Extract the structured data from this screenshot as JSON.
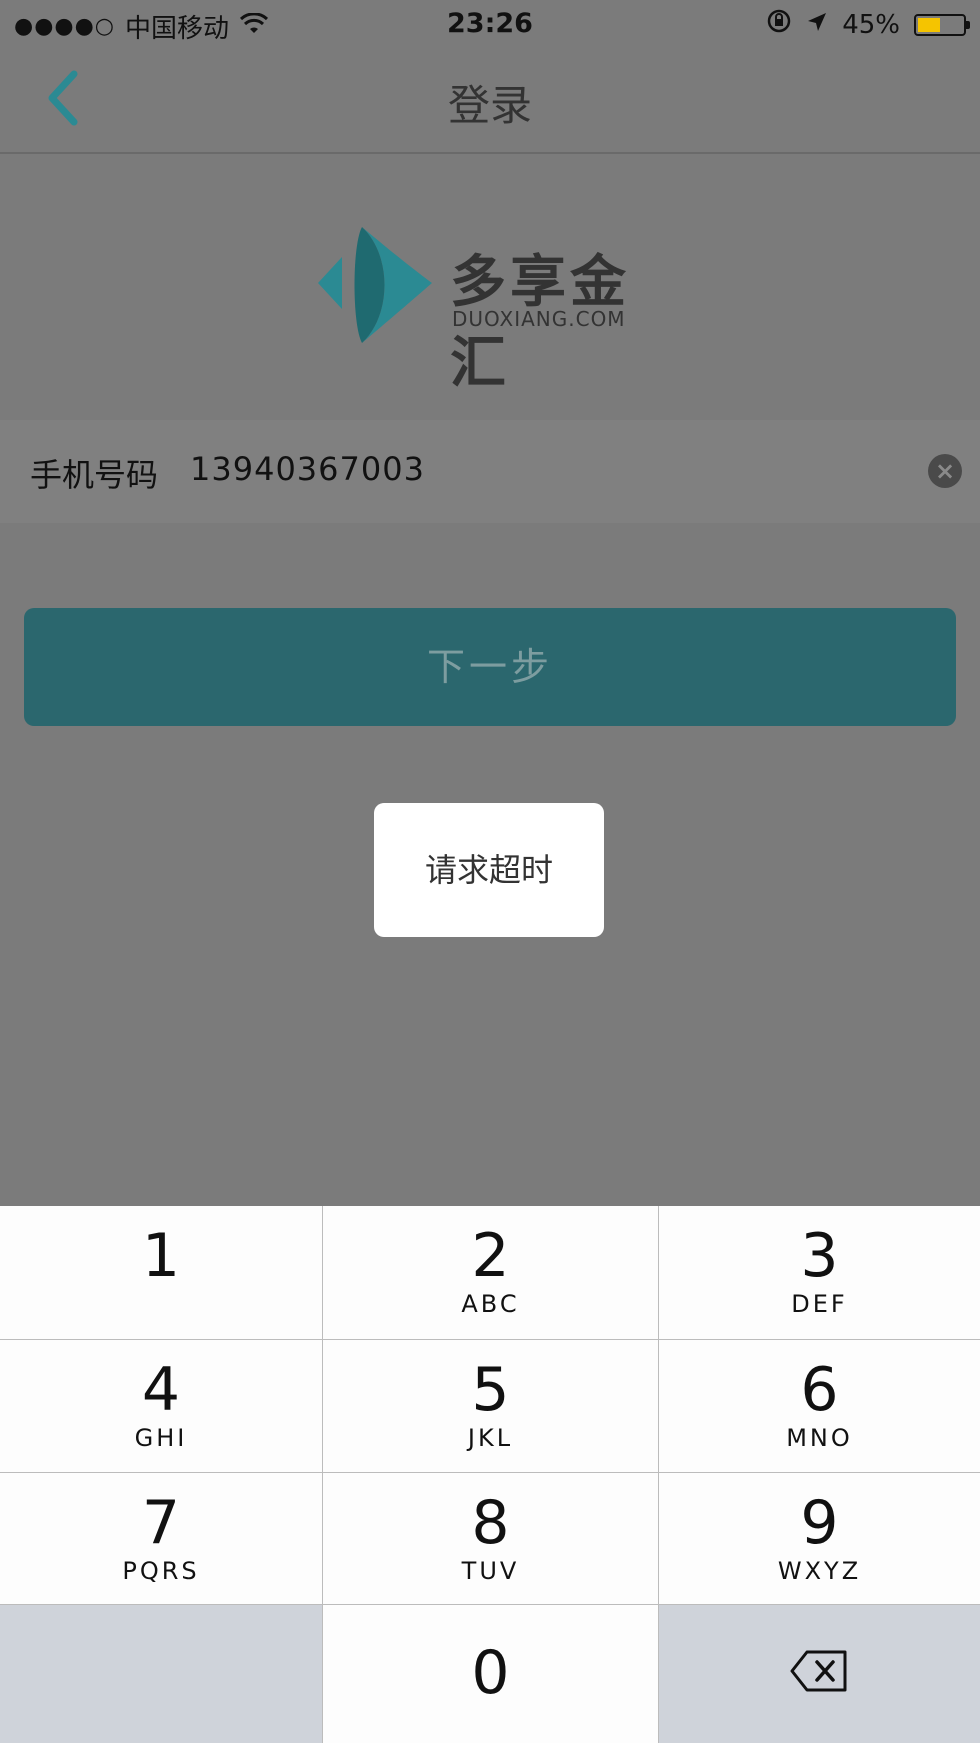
{
  "status_bar": {
    "signal": "●●●●○",
    "carrier": "中国移动",
    "time": "23:26",
    "battery": "45%",
    "icons": [
      "wifi-icon",
      "rotation-lock-icon",
      "location-arrow-icon",
      "battery-icon"
    ]
  },
  "nav": {
    "title": "登录",
    "back_icon": "chevron-left-icon",
    "accent": "#2b8a93"
  },
  "logo": {
    "name": "多享金汇",
    "domain": "DUOXIANG.COM"
  },
  "form": {
    "phone_label": "手机号码",
    "phone_value": "13940367003",
    "clear_icon": "clear-icon"
  },
  "next_button": {
    "label": "下一步",
    "color": "#2b676e"
  },
  "toast": {
    "message": "请求超时"
  },
  "keypad": {
    "keys": [
      {
        "num": "1",
        "letters": ""
      },
      {
        "num": "2",
        "letters": "ABC"
      },
      {
        "num": "3",
        "letters": "DEF"
      },
      {
        "num": "4",
        "letters": "GHI"
      },
      {
        "num": "5",
        "letters": "JKL"
      },
      {
        "num": "6",
        "letters": "MNO"
      },
      {
        "num": "7",
        "letters": "PQRS"
      },
      {
        "num": "8",
        "letters": "TUV"
      },
      {
        "num": "9",
        "letters": "WXYZ"
      },
      {
        "num": "0",
        "letters": ""
      }
    ],
    "delete_icon": "backspace-icon"
  }
}
